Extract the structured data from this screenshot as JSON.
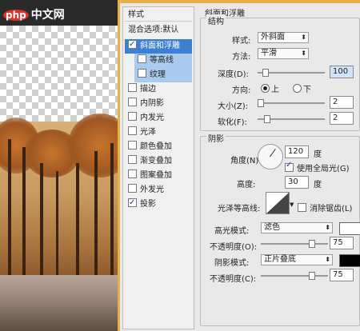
{
  "watermark": {
    "logo": "php",
    "text": "中文网"
  },
  "styles_panel": {
    "header": "样式",
    "blend_options": "混合选项:默认",
    "items": [
      {
        "label": "斜面和浮雕",
        "checked": true,
        "selected": true
      },
      {
        "label": "等高线",
        "checked": false,
        "sub": true
      },
      {
        "label": "纹理",
        "checked": false,
        "sub": true
      },
      {
        "label": "描边",
        "checked": false
      },
      {
        "label": "内阴影",
        "checked": false
      },
      {
        "label": "内发光",
        "checked": false
      },
      {
        "label": "光泽",
        "checked": false
      },
      {
        "label": "颜色叠加",
        "checked": false
      },
      {
        "label": "渐变叠加",
        "checked": false
      },
      {
        "label": "图案叠加",
        "checked": false
      },
      {
        "label": "外发光",
        "checked": false
      },
      {
        "label": "投影",
        "checked": true
      }
    ]
  },
  "bevel": {
    "title": "斜面和浮雕",
    "structure_title": "结构",
    "style_label": "样式:",
    "style_value": "外斜面",
    "method_label": "方法:",
    "method_value": "平滑",
    "depth_label": "深度(D):",
    "depth_value": "100",
    "direction_label": "方向:",
    "direction_up": "上",
    "direction_down": "下",
    "size_label": "大小(Z):",
    "size_value": "2",
    "soften_label": "软化(F):",
    "soften_value": "2"
  },
  "shading": {
    "title": "阴影",
    "angle_label": "角度(N):",
    "angle_value": "120",
    "degree_unit": "度",
    "global_light_label": "使用全局光(G)",
    "altitude_label": "高度:",
    "altitude_value": "30",
    "gloss_contour_label": "光泽等高线:",
    "anti_alias_label": "消除锯齿(L)",
    "highlight_mode_label": "高光模式:",
    "highlight_mode_value": "滤色",
    "opacity_label": "不透明度(O):",
    "opacity_value": "75",
    "shadow_mode_label": "阴影模式:",
    "shadow_mode_value": "正片叠底",
    "shadow_opacity_label": "不透明度(C):",
    "shadow_opacity_value": "75",
    "highlight_color": "#ffffff",
    "shadow_color": "#000000"
  },
  "colors": {
    "accent": "#3d7fd1",
    "frame": "#e8b04a"
  }
}
